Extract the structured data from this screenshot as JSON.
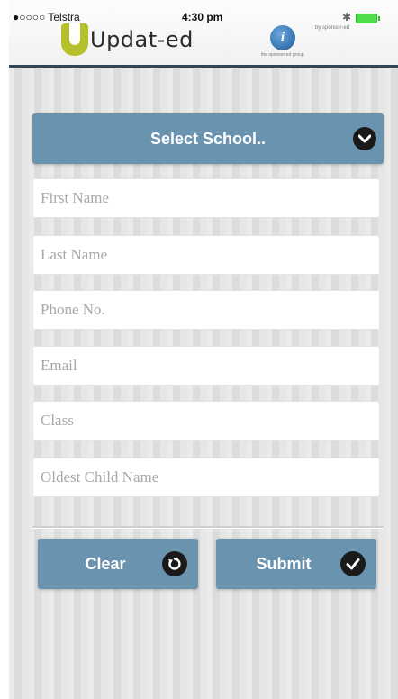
{
  "status_bar": {
    "carrier": "●○○○○ Telstra",
    "time": "4:30 pm",
    "bluetooth": "✱"
  },
  "header": {
    "app_name": "Updat-ed",
    "sponsor_text": "by sponsor-ed",
    "sponsor_small": "the sponsor-ed group"
  },
  "form": {
    "select_school_label": "Select School..",
    "fields": [
      {
        "placeholder": "First Name",
        "value": ""
      },
      {
        "placeholder": "Last Name",
        "value": ""
      },
      {
        "placeholder": "Phone No.",
        "value": ""
      },
      {
        "placeholder": "Email",
        "value": ""
      },
      {
        "placeholder": "Class",
        "value": ""
      },
      {
        "placeholder": "Oldest Child Name",
        "value": ""
      }
    ]
  },
  "actions": {
    "clear_label": "Clear",
    "submit_label": "Submit"
  },
  "colors": {
    "button_bg": "#6a93b0",
    "header_border": "#2f4656",
    "logo_accent": "#b5c02a",
    "background": "#e3e3e3"
  },
  "icons": {
    "select_school": "chevron-down-icon",
    "clear": "refresh-icon",
    "submit": "check-icon",
    "logo": "info-badge-icon"
  }
}
